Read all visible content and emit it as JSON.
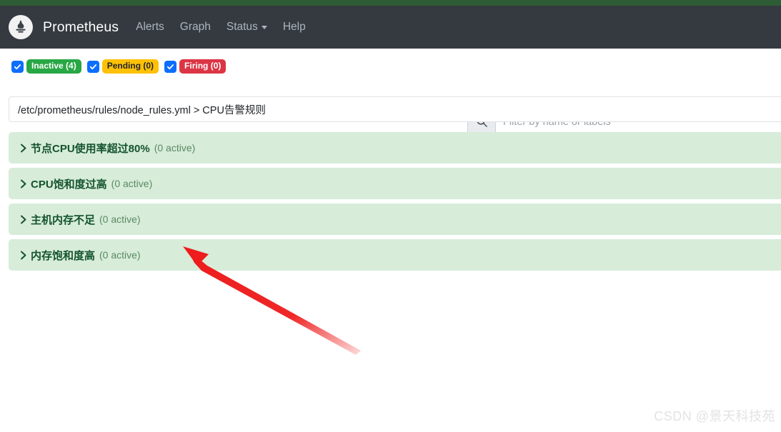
{
  "navbar": {
    "logo_icon": "prometheus-torch-icon",
    "brand": "Prometheus",
    "links": [
      {
        "label": "Alerts",
        "has_caret": false
      },
      {
        "label": "Graph",
        "has_caret": false
      },
      {
        "label": "Status",
        "has_caret": true
      },
      {
        "label": "Help",
        "has_caret": false
      }
    ]
  },
  "filters": {
    "badges": [
      {
        "label": "Inactive (4)",
        "state": "inactive",
        "checked": true,
        "color": "#28a745"
      },
      {
        "label": "Pending (0)",
        "state": "pending",
        "checked": true,
        "color": "#ffc107"
      },
      {
        "label": "Firing (0)",
        "state": "firing",
        "checked": true,
        "color": "#dc3545"
      }
    ],
    "search": {
      "icon": "search-icon",
      "placeholder": "Filter by name or labels",
      "value": ""
    }
  },
  "breadcrumb": {
    "file_path": "/etc/prometheus/rules/node_rules.yml",
    "separator": ">",
    "group_name": "CPU告警规则",
    "full_text": "/etc/prometheus/rules/node_rules.yml > CPU告警规则"
  },
  "rules": [
    {
      "name": "节点CPU使用率超过80%",
      "active": "(0 active)",
      "expanded": false
    },
    {
      "name": "CPU饱和度过高",
      "active": "(0 active)",
      "expanded": false
    },
    {
      "name": "主机内存不足",
      "active": "(0 active)",
      "expanded": false
    },
    {
      "name": "内存饱和度高",
      "active": "(0 active)",
      "expanded": false
    }
  ],
  "annotation": {
    "arrow_color": "#ee1c1c",
    "points_to": "内存饱和度高"
  },
  "watermark": {
    "text": "CSDN @景天科技苑"
  },
  "colors": {
    "top_strip": "#2e5c34",
    "navbar": "#343a40",
    "rule_row_bg": "#d7ecd9",
    "rule_text": "#14532d",
    "checkbox": "#0d6efd"
  }
}
